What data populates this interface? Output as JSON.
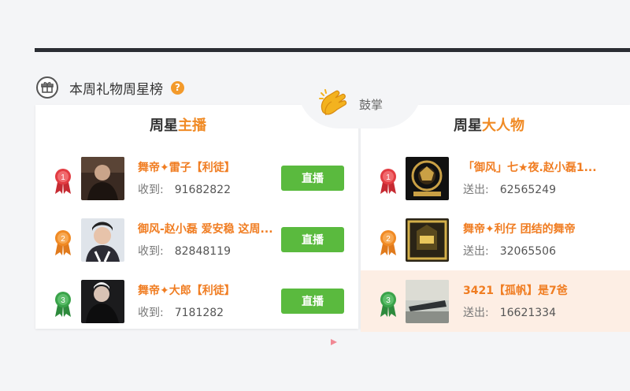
{
  "section": {
    "title": "本周礼物周星榜",
    "help": "?"
  },
  "clap": {
    "label": "鼓掌"
  },
  "left_panel": {
    "title_prefix": "周星",
    "title_highlight": "主播",
    "received_label": "收到:",
    "live_label": "直播",
    "rows": [
      {
        "rank": "1",
        "name": "舞帝✦雷子【利徒】",
        "value": "91682822"
      },
      {
        "rank": "2",
        "name": "御风-赵小磊 爱安稳 这周...",
        "value": "82848119"
      },
      {
        "rank": "3",
        "name": "舞帝✦大郎【利徒】",
        "value": "7181282"
      }
    ]
  },
  "right_panel": {
    "title_prefix": "周星",
    "title_highlight": "大人物",
    "sent_label": "送出:",
    "rows": [
      {
        "rank": "1",
        "name": "「御风」七★夜.赵小磊1...",
        "value": "62565249"
      },
      {
        "rank": "2",
        "name": "舞帝✦利仔 团结的舞帝",
        "value": "32065506"
      },
      {
        "rank": "3",
        "name": "3421【孤帆】是7爸",
        "value": "16621334"
      }
    ]
  },
  "colors": {
    "accent": "#f08a24",
    "live_button": "#5aba3e",
    "medal_gold": "#d9343a",
    "medal_silver": "#f08a24",
    "medal_bronze": "#3aa34a",
    "highlight_row": "#fdeee4"
  },
  "icons": {
    "gift": "gift-icon",
    "help": "help-icon",
    "clap": "clap-hands-icon",
    "medal": "medal-ribbon-icon"
  }
}
